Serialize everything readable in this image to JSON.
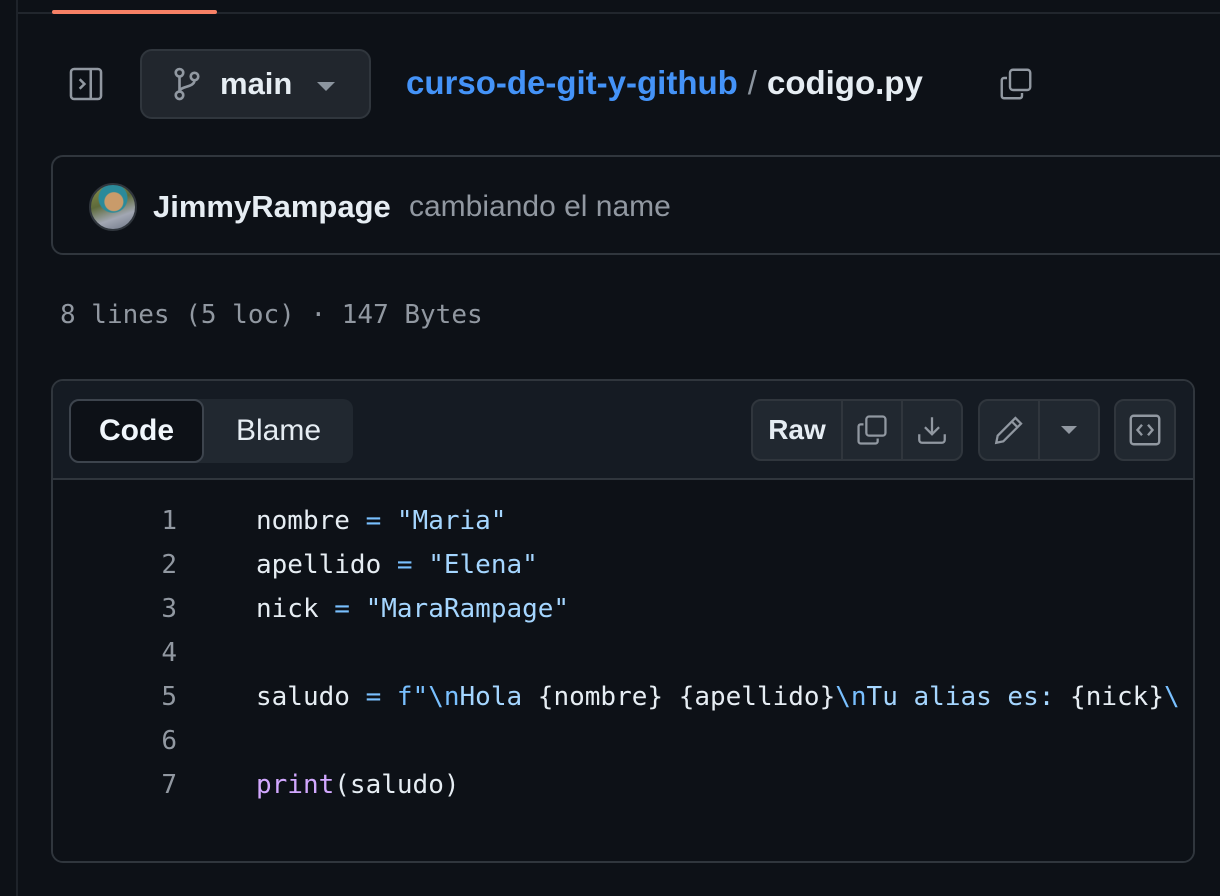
{
  "colors": {
    "background": "#0d1117",
    "link": "#4493f8",
    "accent_underline": "#f78166",
    "string": "#a5d6ff",
    "operator": "#79c0ff",
    "function": "#d2a8ff"
  },
  "header": {
    "branch": "main",
    "repo": "curso-de-git-y-github",
    "separator": "/",
    "file": "codigo.py",
    "icons": [
      "sidebar-toggle-icon",
      "git-branch-icon",
      "caret-down-icon",
      "copy-icon"
    ]
  },
  "commit": {
    "author": "JimmyRampage",
    "message": "cambiando el name"
  },
  "file_meta": "8 lines (5 loc) · 147 Bytes",
  "code_view": {
    "tabs": [
      {
        "label": "Code",
        "active": true
      },
      {
        "label": "Blame",
        "active": false
      }
    ],
    "raw_label": "Raw",
    "icons": [
      "copy-icon",
      "download-icon",
      "pencil-icon",
      "caret-down-icon",
      "code-square-icon"
    ]
  },
  "code": {
    "lines": [
      {
        "n": "1",
        "tokens": [
          {
            "t": "nombre ",
            "c": ""
          },
          {
            "t": "=",
            "c": "op"
          },
          {
            "t": " ",
            "c": ""
          },
          {
            "t": "\"Maria\"",
            "c": "str"
          }
        ]
      },
      {
        "n": "2",
        "tokens": [
          {
            "t": "apellido ",
            "c": ""
          },
          {
            "t": "=",
            "c": "op"
          },
          {
            "t": " ",
            "c": ""
          },
          {
            "t": "\"Elena\"",
            "c": "str"
          }
        ]
      },
      {
        "n": "3",
        "tokens": [
          {
            "t": "nick ",
            "c": ""
          },
          {
            "t": "=",
            "c": "op"
          },
          {
            "t": " ",
            "c": ""
          },
          {
            "t": "\"MaraRampage\"",
            "c": "str"
          }
        ]
      },
      {
        "n": "4",
        "tokens": []
      },
      {
        "n": "5",
        "tokens": [
          {
            "t": "saludo ",
            "c": ""
          },
          {
            "t": "=",
            "c": "op"
          },
          {
            "t": " ",
            "c": ""
          },
          {
            "t": "f\"",
            "c": "op"
          },
          {
            "t": "\\n",
            "c": "esc"
          },
          {
            "t": "Hola ",
            "c": "str"
          },
          {
            "t": "{nombre}",
            "c": ""
          },
          {
            "t": " ",
            "c": "str"
          },
          {
            "t": "{apellido}",
            "c": ""
          },
          {
            "t": "\\n",
            "c": "esc"
          },
          {
            "t": "Tu alias es: ",
            "c": "str"
          },
          {
            "t": "{nick}",
            "c": ""
          },
          {
            "t": "\\",
            "c": "esc"
          }
        ]
      },
      {
        "n": "6",
        "tokens": []
      },
      {
        "n": "7",
        "tokens": [
          {
            "t": "print",
            "c": "fn"
          },
          {
            "t": "(saludo)",
            "c": ""
          }
        ]
      }
    ]
  }
}
